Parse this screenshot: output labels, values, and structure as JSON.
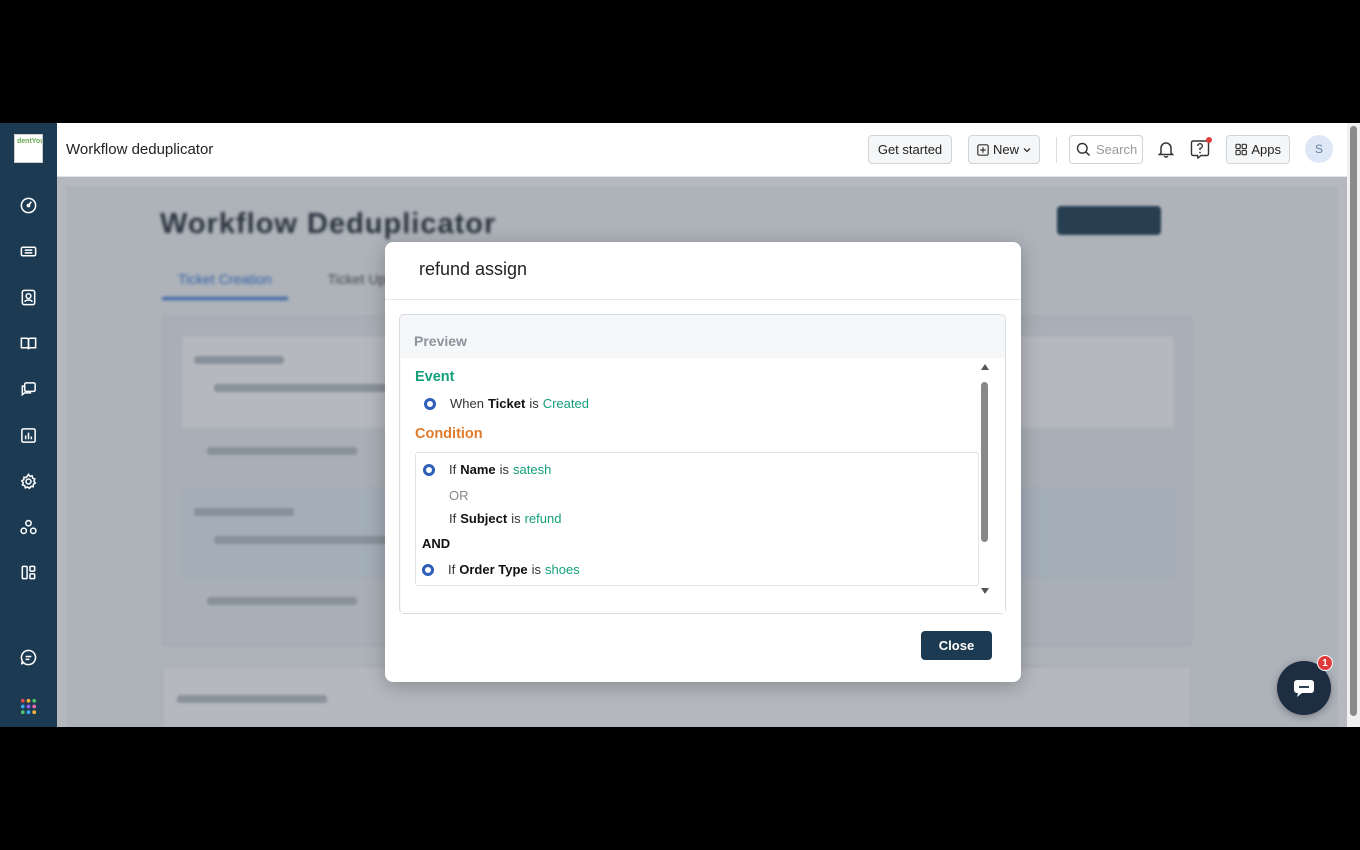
{
  "app": {
    "logo_text": "dentYou",
    "title": "Workflow deduplicator"
  },
  "topbar": {
    "get_started_label": "Get started",
    "new_label": "New",
    "search_placeholder": "Search",
    "apps_label": "Apps",
    "avatar_initial": "S"
  },
  "sidebar": {
    "items": [
      {
        "icon": "dashboard-icon"
      },
      {
        "icon": "tickets-icon"
      },
      {
        "icon": "contacts-icon"
      },
      {
        "icon": "knowledge-base-icon"
      },
      {
        "icon": "conversations-icon"
      },
      {
        "icon": "reports-icon"
      },
      {
        "icon": "settings-icon"
      },
      {
        "icon": "groups-icon"
      },
      {
        "icon": "apps-grid-icon"
      },
      {
        "icon": "chat-icon"
      },
      {
        "icon": "app-switcher-icon"
      }
    ]
  },
  "background": {
    "page_heading": "Workflow Deduplicator",
    "tabs": [
      "Ticket Creation",
      "Ticket Upd"
    ]
  },
  "modal": {
    "title": "refund assign",
    "preview_label": "Preview",
    "event_heading": "Event",
    "event": {
      "prefix": "When",
      "field": "Ticket",
      "op": "is",
      "value": "Created"
    },
    "condition_heading": "Condition",
    "conditions": [
      {
        "prefix": "If",
        "field": "Name",
        "op": "is",
        "value": "satesh"
      },
      {
        "joiner": "OR"
      },
      {
        "prefix": "If",
        "field": "Subject",
        "op": "is",
        "value": "refund"
      },
      {
        "joiner": "AND"
      },
      {
        "prefix": "If",
        "field": "Order Type",
        "op": "is",
        "value": "shoes"
      }
    ],
    "close_label": "Close"
  },
  "chat_widget": {
    "badge_count": "1"
  },
  "colors": {
    "sidebar_bg": "#1c3a52",
    "event_green": "#12a07a",
    "condition_orange": "#e07b2c",
    "radio_blue": "#2f5eb8",
    "close_button": "#1c3a52"
  }
}
